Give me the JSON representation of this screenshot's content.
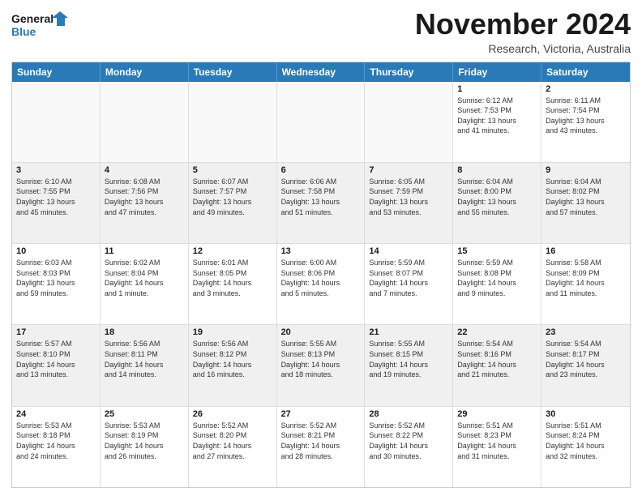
{
  "logo": {
    "line1": "General",
    "line2": "Blue"
  },
  "title": "November 2024",
  "subtitle": "Research, Victoria, Australia",
  "header_days": [
    "Sunday",
    "Monday",
    "Tuesday",
    "Wednesday",
    "Thursday",
    "Friday",
    "Saturday"
  ],
  "rows": [
    [
      {
        "day": "",
        "info": "",
        "empty": true
      },
      {
        "day": "",
        "info": "",
        "empty": true
      },
      {
        "day": "",
        "info": "",
        "empty": true
      },
      {
        "day": "",
        "info": "",
        "empty": true
      },
      {
        "day": "",
        "info": "",
        "empty": true
      },
      {
        "day": "1",
        "info": "Sunrise: 6:12 AM\nSunset: 7:53 PM\nDaylight: 13 hours\nand 41 minutes."
      },
      {
        "day": "2",
        "info": "Sunrise: 6:11 AM\nSunset: 7:54 PM\nDaylight: 13 hours\nand 43 minutes."
      }
    ],
    [
      {
        "day": "3",
        "info": "Sunrise: 6:10 AM\nSunset: 7:55 PM\nDaylight: 13 hours\nand 45 minutes.",
        "shaded": true
      },
      {
        "day": "4",
        "info": "Sunrise: 6:08 AM\nSunset: 7:56 PM\nDaylight: 13 hours\nand 47 minutes.",
        "shaded": true
      },
      {
        "day": "5",
        "info": "Sunrise: 6:07 AM\nSunset: 7:57 PM\nDaylight: 13 hours\nand 49 minutes.",
        "shaded": true
      },
      {
        "day": "6",
        "info": "Sunrise: 6:06 AM\nSunset: 7:58 PM\nDaylight: 13 hours\nand 51 minutes.",
        "shaded": true
      },
      {
        "day": "7",
        "info": "Sunrise: 6:05 AM\nSunset: 7:59 PM\nDaylight: 13 hours\nand 53 minutes.",
        "shaded": true
      },
      {
        "day": "8",
        "info": "Sunrise: 6:04 AM\nSunset: 8:00 PM\nDaylight: 13 hours\nand 55 minutes.",
        "shaded": true
      },
      {
        "day": "9",
        "info": "Sunrise: 6:04 AM\nSunset: 8:02 PM\nDaylight: 13 hours\nand 57 minutes.",
        "shaded": true
      }
    ],
    [
      {
        "day": "10",
        "info": "Sunrise: 6:03 AM\nSunset: 8:03 PM\nDaylight: 13 hours\nand 59 minutes."
      },
      {
        "day": "11",
        "info": "Sunrise: 6:02 AM\nSunset: 8:04 PM\nDaylight: 14 hours\nand 1 minute."
      },
      {
        "day": "12",
        "info": "Sunrise: 6:01 AM\nSunset: 8:05 PM\nDaylight: 14 hours\nand 3 minutes."
      },
      {
        "day": "13",
        "info": "Sunrise: 6:00 AM\nSunset: 8:06 PM\nDaylight: 14 hours\nand 5 minutes."
      },
      {
        "day": "14",
        "info": "Sunrise: 5:59 AM\nSunset: 8:07 PM\nDaylight: 14 hours\nand 7 minutes."
      },
      {
        "day": "15",
        "info": "Sunrise: 5:59 AM\nSunset: 8:08 PM\nDaylight: 14 hours\nand 9 minutes."
      },
      {
        "day": "16",
        "info": "Sunrise: 5:58 AM\nSunset: 8:09 PM\nDaylight: 14 hours\nand 11 minutes."
      }
    ],
    [
      {
        "day": "17",
        "info": "Sunrise: 5:57 AM\nSunset: 8:10 PM\nDaylight: 14 hours\nand 13 minutes.",
        "shaded": true
      },
      {
        "day": "18",
        "info": "Sunrise: 5:56 AM\nSunset: 8:11 PM\nDaylight: 14 hours\nand 14 minutes.",
        "shaded": true
      },
      {
        "day": "19",
        "info": "Sunrise: 5:56 AM\nSunset: 8:12 PM\nDaylight: 14 hours\nand 16 minutes.",
        "shaded": true
      },
      {
        "day": "20",
        "info": "Sunrise: 5:55 AM\nSunset: 8:13 PM\nDaylight: 14 hours\nand 18 minutes.",
        "shaded": true
      },
      {
        "day": "21",
        "info": "Sunrise: 5:55 AM\nSunset: 8:15 PM\nDaylight: 14 hours\nand 19 minutes.",
        "shaded": true
      },
      {
        "day": "22",
        "info": "Sunrise: 5:54 AM\nSunset: 8:16 PM\nDaylight: 14 hours\nand 21 minutes.",
        "shaded": true
      },
      {
        "day": "23",
        "info": "Sunrise: 5:54 AM\nSunset: 8:17 PM\nDaylight: 14 hours\nand 23 minutes.",
        "shaded": true
      }
    ],
    [
      {
        "day": "24",
        "info": "Sunrise: 5:53 AM\nSunset: 8:18 PM\nDaylight: 14 hours\nand 24 minutes."
      },
      {
        "day": "25",
        "info": "Sunrise: 5:53 AM\nSunset: 8:19 PM\nDaylight: 14 hours\nand 26 minutes."
      },
      {
        "day": "26",
        "info": "Sunrise: 5:52 AM\nSunset: 8:20 PM\nDaylight: 14 hours\nand 27 minutes."
      },
      {
        "day": "27",
        "info": "Sunrise: 5:52 AM\nSunset: 8:21 PM\nDaylight: 14 hours\nand 28 minutes."
      },
      {
        "day": "28",
        "info": "Sunrise: 5:52 AM\nSunset: 8:22 PM\nDaylight: 14 hours\nand 30 minutes."
      },
      {
        "day": "29",
        "info": "Sunrise: 5:51 AM\nSunset: 8:23 PM\nDaylight: 14 hours\nand 31 minutes."
      },
      {
        "day": "30",
        "info": "Sunrise: 5:51 AM\nSunset: 8:24 PM\nDaylight: 14 hours\nand 32 minutes."
      }
    ]
  ]
}
